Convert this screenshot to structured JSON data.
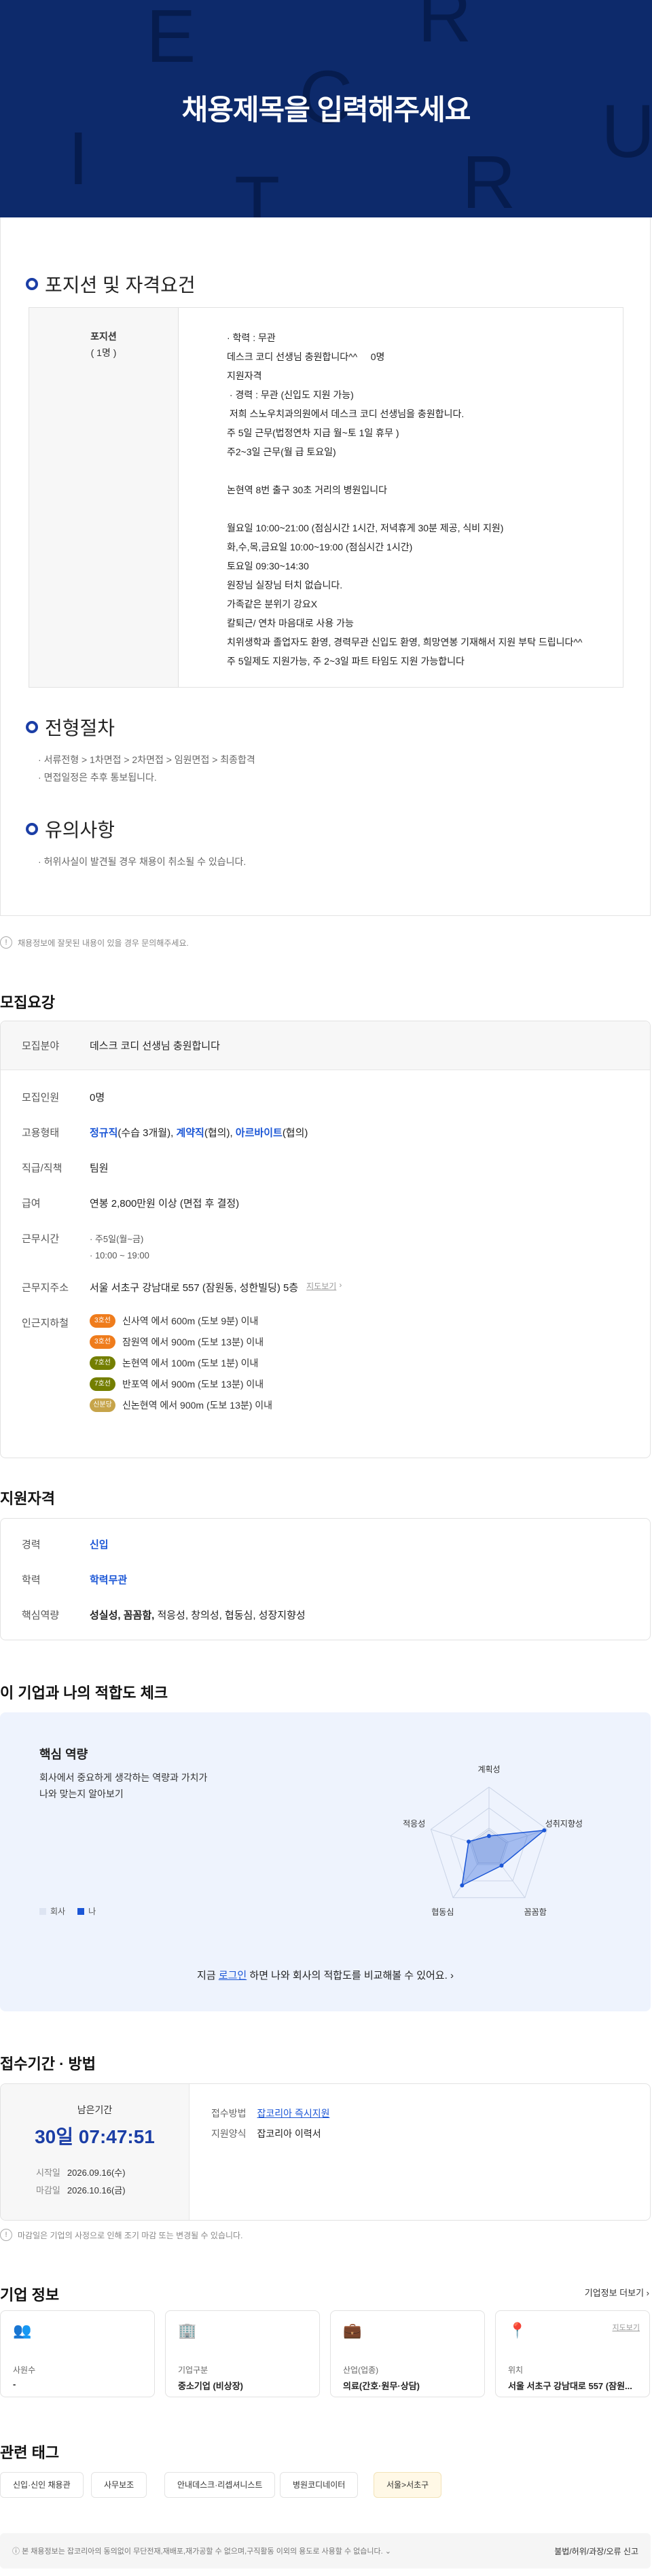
{
  "hero": {
    "title": "채용제목을 입력해주세요",
    "bg_letters": [
      "E",
      "R",
      "C",
      "U",
      "I",
      "T",
      "R"
    ]
  },
  "sections": {
    "position_title": "포지션 및 자격요건",
    "position_name": "포지션",
    "position_count": "( 1명 )",
    "position_body": "· 학력 : 무관\n데스크 코디 선생님 충원합니다^^     0명\n지원자격\n · 경력 : 무관 (신입도 지원 가능)\n 저희 스노우치과의원에서 데스크 코디 선생님을 충원합니다.\n주 5일 근무(법정연차 지급 월~토 1일 휴무 )\n주2~3일 근무(월 급 토요일)\n\n논현역 8번 출구 30초 거리의 병원입니다\n\n월요일 10:00~21:00 (점심시간 1시간, 저녁휴게 30분 제공, 식비 지원)\n화,수,목,금요일 10:00~19:00 (점심시간 1시간)\n토요일 09:30~14:30\n원장님 실장님 터치 없습니다.\n가족같은 분위기 강요X\n칼퇴근/ 연차 마음대로 사용 가능\n치위생학과 졸업자도 환영, 경력무관 신입도 환영, 희망연봉 기재해서 지원 부탁 드립니다^^\n주 5일제도 지원가능, 주 2~3일 파트 타임도 지원 가능합니다",
    "process_title": "전형절차",
    "process_steps": "서류전형 > 1차면접 > 2차면접 > 임원면접 > 최종합격",
    "process_note": "면접일정은 추후 통보됩니다.",
    "caution_title": "유의사항",
    "caution_text": "허위사실이 발견될 경우 채용이 취소될 수 있습니다.",
    "report_note": "채용정보에 잘못된 내용이 있을 경우 문의해주세요."
  },
  "recruit": {
    "title": "모집요강",
    "field_k": "모집분야",
    "field_v": "데스크 코디 선생님 충원합니다",
    "count_k": "모집인원",
    "count_v": "0명",
    "type_k": "고용형태",
    "type_a": "정규직",
    "type_a2": "(수습 3개월), ",
    "type_b": "계약직",
    "type_b2": "(협의), ",
    "type_c": "아르바이트",
    "type_c2": "(협의)",
    "rank_k": "직급/직책",
    "rank_v": "팀원",
    "pay_k": "급여",
    "pay_v": "연봉 2,800만원 이상 (면접 후 결정)",
    "time_k": "근무시간",
    "time_v1": "주5일(월~금)",
    "time_v2": "10:00 ~ 19:00",
    "addr_k": "근무지주소",
    "addr_v": "서울 서초구 강남대로 557 (잠원동, 성한빌딩) 5층",
    "addr_map": "지도보기",
    "subway_k": "인근지하철",
    "stations": [
      {
        "line": "3호선",
        "text": "신사역 에서 600m (도보 9분) 이내",
        "color": "#ef7c1c"
      },
      {
        "line": "3호선",
        "text": "잠원역 에서 900m (도보 13분) 이내",
        "color": "#ef7c1c"
      },
      {
        "line": "7호선",
        "text": "논현역 에서 100m (도보 1분) 이내",
        "color": "#747f00"
      },
      {
        "line": "7호선",
        "text": "반포역 에서 900m (도보 13분) 이내",
        "color": "#747f00"
      },
      {
        "line": "신분당",
        "text": "신논현역 에서 900m (도보 13분) 이내",
        "color": "#c6a44a"
      }
    ]
  },
  "qual": {
    "title": "지원자격",
    "career_k": "경력",
    "career_v": "신입",
    "edu_k": "학력",
    "edu_v": "학력무관",
    "skill_k": "핵심역량",
    "skill_bold": "성실성, 꼼꼼함,",
    "skill_rest": " 적응성, 창의성, 협동심, 성장지향성"
  },
  "fit": {
    "title": "이 기업과 나의 적합도 체크",
    "sub_title": "핵심 역량",
    "desc1": "회사에서 중요하게 생각하는 역량과 가치가",
    "desc2": "나와 맞는지 알아보기",
    "legend_company": "회사",
    "legend_me": "나",
    "axes": [
      "계획성",
      "성취지향성",
      "꼼꼼함",
      "협동심",
      "적응성"
    ],
    "cta_pre": "지금 ",
    "cta_link": "로그인",
    "cta_post": " 하면 나와 회사의 적합도를 비교해볼 수 있어요.",
    "company_values": [
      0.3,
      0.3,
      0.3,
      0.3,
      0.3
    ],
    "me_values": [
      0.2,
      0.95,
      0.35,
      0.75,
      0.35
    ]
  },
  "apply": {
    "title": "접수기간 · 방법",
    "remain_label": "남은기간",
    "remain_value": "30일 07:47:51",
    "start_k": "시작일",
    "start_v": "2026.09.16(수)",
    "end_k": "마감일",
    "end_v": "2026.10.16(금)",
    "method_k": "접수방법",
    "method_v": "잡코리아 즉시지원",
    "form_k": "지원양식",
    "form_v": "잡코리아 이력서",
    "note": "마감일은 기업의 사정으로 인해 조기 마감 또는 변경될 수 있습니다."
  },
  "company": {
    "title": "기업 정보",
    "more": "기업정보 더보기",
    "cards": [
      {
        "label": "사원수",
        "value": "-",
        "icon": "people-icon"
      },
      {
        "label": "기업구분",
        "value": "중소기업 (비상장)",
        "icon": "building-icon"
      },
      {
        "label": "산업(업종)",
        "value": "의료(간호·원무·상담)",
        "icon": "briefcase-icon"
      },
      {
        "label": "위치",
        "value": "서울 서초구 강남대로 557 (잠원...",
        "icon": "location-icon",
        "extra": "지도보기"
      }
    ]
  },
  "tags": {
    "title": "관련 태그",
    "items": [
      "신입·신인 채용관",
      "사무보조",
      "안내데스크·리셉셔니스트",
      "병원코디네이터",
      "서울>서초구"
    ]
  },
  "footer": {
    "text": "본 채용정보는 잡코리아의 동의없이 무단전재,재배포,재가공할 수 없으며,구직활동 이외의 용도로 사용할 수 없습니다.",
    "report": "불법/허위/과장/오류 신고"
  }
}
